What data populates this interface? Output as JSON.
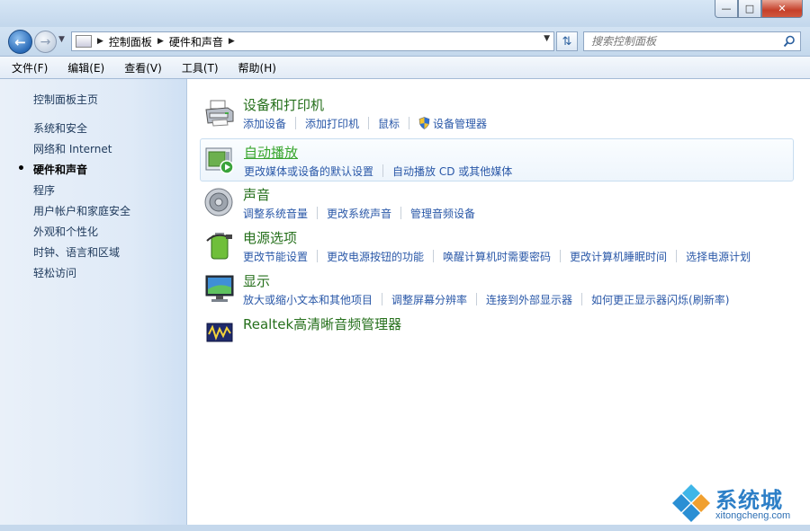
{
  "window": {
    "minimize_label": "—",
    "maximize_label": "□",
    "close_label": "✕"
  },
  "address": {
    "crumbs": [
      "控制面板",
      "硬件和声音"
    ],
    "search_placeholder": "搜索控制面板"
  },
  "menu": [
    "文件(F)",
    "编辑(E)",
    "查看(V)",
    "工具(T)",
    "帮助(H)"
  ],
  "sidebar": {
    "home": "控制面板主页",
    "items": [
      "系统和安全",
      "网络和 Internet",
      "硬件和声音",
      "程序",
      "用户帐户和家庭安全",
      "外观和个性化",
      "时钟、语言和区域",
      "轻松访问"
    ],
    "current_index": 2
  },
  "categories": [
    {
      "title": "设备和打印机",
      "icon": "printer-icon",
      "links": [
        "添加设备",
        "添加打印机",
        "鼠标",
        "设备管理器"
      ]
    },
    {
      "title": "自动播放",
      "icon": "autoplay-icon",
      "links": [
        "更改媒体或设备的默认设置",
        "自动播放 CD 或其他媒体"
      ]
    },
    {
      "title": "声音",
      "icon": "speaker-icon",
      "links": [
        "调整系统音量",
        "更改系统声音",
        "管理音频设备"
      ]
    },
    {
      "title": "电源选项",
      "icon": "power-battery-icon",
      "links": [
        "更改节能设置",
        "更改电源按钮的功能",
        "唤醒计算机时需要密码",
        "更改计算机睡眠时间",
        "选择电源计划"
      ]
    },
    {
      "title": "显示",
      "icon": "monitor-icon",
      "links": [
        "放大或缩小文本和其他项目",
        "调整屏幕分辨率",
        "连接到外部显示器",
        "如何更正显示器闪烁(刷新率)"
      ]
    },
    {
      "title": "Realtek高清晰音频管理器",
      "icon": "realtek-audio-icon",
      "links": []
    }
  ],
  "watermark": {
    "name": "系统城",
    "url": "xitongcheng.com"
  },
  "colors": {
    "category_title": "#26701c",
    "link": "#2a58a8",
    "sidebar_text": "#1e395b"
  }
}
